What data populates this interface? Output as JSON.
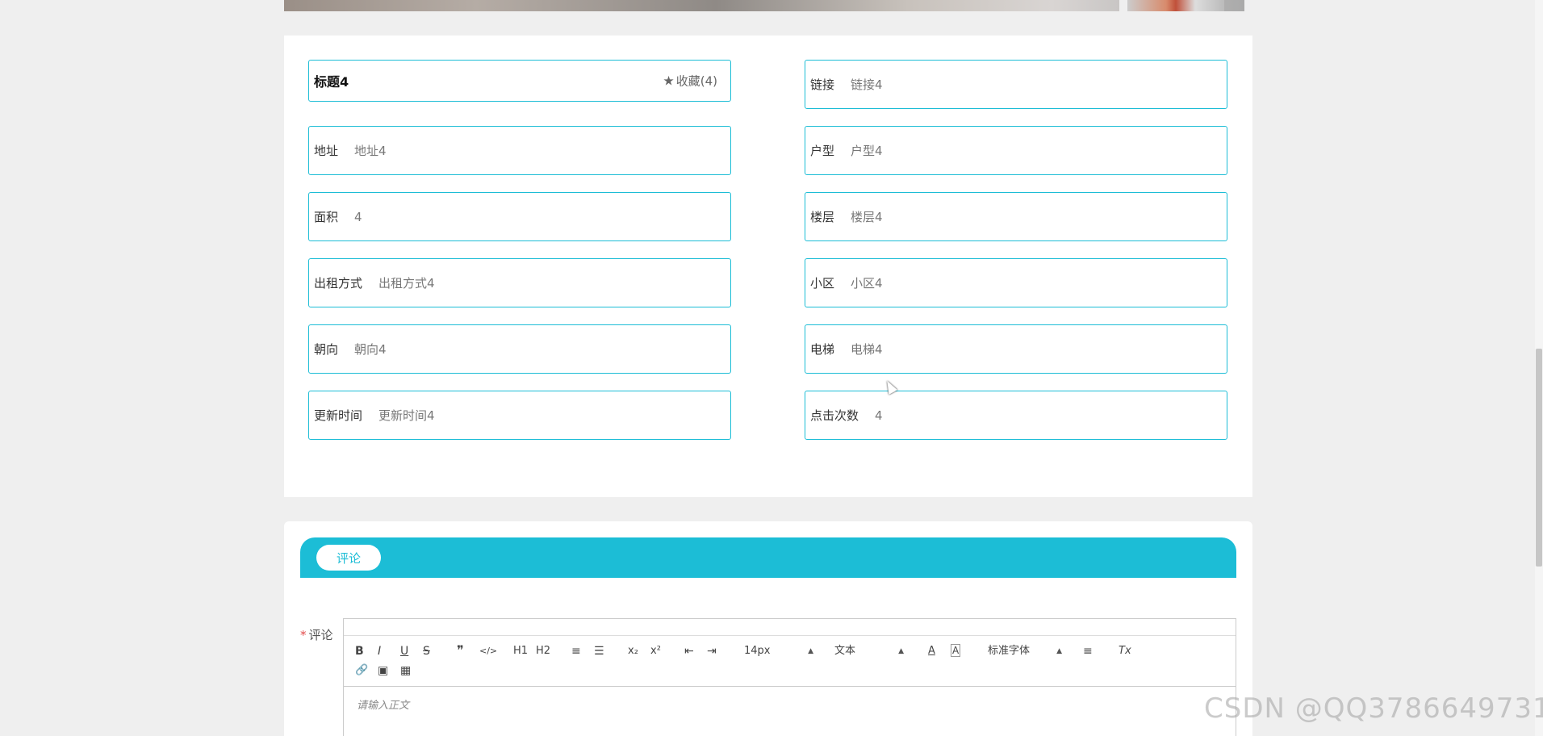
{
  "detail": {
    "title": "标题4",
    "favorite_label": "收藏(4)",
    "fields_left": [
      {
        "label": "地址",
        "value": "地址4"
      },
      {
        "label": "面积",
        "value": "4"
      },
      {
        "label": "出租方式",
        "value": "出租方式4"
      },
      {
        "label": "朝向",
        "value": "朝向4"
      },
      {
        "label": "更新时间",
        "value": "更新时间4"
      }
    ],
    "fields_right": [
      {
        "label": "链接",
        "value": "链接4"
      },
      {
        "label": "户型",
        "value": "户型4"
      },
      {
        "label": "楼层",
        "value": "楼层4"
      },
      {
        "label": "小区",
        "value": "小区4"
      },
      {
        "label": "电梯",
        "value": "电梯4"
      },
      {
        "label": "点击次数",
        "value": "4"
      }
    ]
  },
  "comment": {
    "tab_label": "评论",
    "field_label": "评论",
    "required_mark": "*",
    "placeholder": "请输入正文",
    "toolbar": {
      "bold": "B",
      "italic": "I",
      "underline": "U",
      "strike": "S",
      "quote": "❞",
      "code": "</>",
      "h1": "H1",
      "h2": "H2",
      "ordered_list": "≡",
      "bullet_list": "☰",
      "subscript": "x₂",
      "superscript": "x²",
      "outdent": "⇤",
      "indent": "⇥",
      "size_value": "14px",
      "header_value": "文本",
      "font_value": "标准字体",
      "align": "≡",
      "clean": "Tx",
      "link": "🔗",
      "image": "▣",
      "video": "▦"
    }
  },
  "colors": {
    "accent": "#1cbdd6"
  },
  "watermark": "CSDN @QQ3786649731"
}
